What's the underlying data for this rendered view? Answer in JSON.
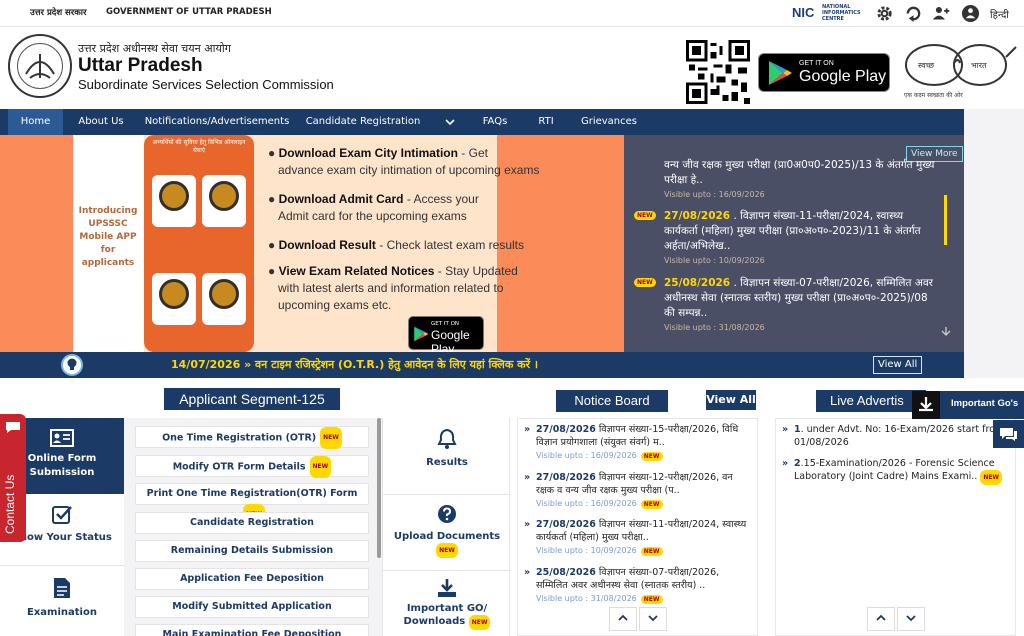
{
  "topbar": {
    "state_hi": "उत्तर प्रदेश सरकार",
    "state_en": "GOVERNMENT OF UTTAR PRADESH",
    "nic_logo": "NIC",
    "nic_sub1": "NATIONAL",
    "nic_sub2": "INFORMATICS",
    "nic_sub3": "CENTRE",
    "icons": [
      "settings-gear-icon",
      "refresh-icon",
      "accessibility-users-icon",
      "screen-reader-icon"
    ],
    "language": "हिन्दी"
  },
  "header": {
    "org_hi": "उत्तर प्रदेश अधीनस्थ सेवा चयन आयोग",
    "org_line1": "Uttar Pradesh",
    "org_line2": "Subordinate Services Selection Commission",
    "gplay_small": "GET IT ON",
    "gplay_big": "Google Play",
    "swachh_1": "स्वच्छ",
    "swachh_2": "भारत",
    "swachh_tag": "एक कदम स्वच्छता की ओर"
  },
  "nav": [
    {
      "label": "Home"
    },
    {
      "label": "About Us"
    },
    {
      "label": "Notifications/Advertisements"
    },
    {
      "label": "Candidate Registration"
    },
    {
      "label": "FAQs"
    },
    {
      "label": "RTI"
    },
    {
      "label": "Grievances"
    }
  ],
  "banner": {
    "mobile_text": "Introducing UPSSSC Mobile APP for applicants",
    "phone_header": "अभ्यर्थियों की सुविधा हेतु विभिन्न ऑनलाइन सेवाएं",
    "lines": [
      {
        "bold": "Download Exam City Intimation",
        "rest": " - Get",
        "line2": "advance exam city intimation of upcoming exams"
      },
      {
        "bold": "Download Admit Card",
        "rest": " - Access your",
        "line2": "Admit card for the upcoming exams"
      },
      {
        "bold": "Download Result",
        "rest": " - Check latest exam results",
        "line2": ""
      },
      {
        "bold": "View Exam Related Notices",
        "rest": " - Stay Updated",
        "line2": "with latest alerts and information related to",
        "line3": "upcoming exams etc."
      }
    ],
    "gp_small": "GET IT ON",
    "gp_big": "Google Play"
  },
  "news": {
    "view_more": "View More",
    "new_label": "NEW",
    "items": [
      {
        "date": "",
        "text": "वन्य जीव रक्षक मुख्य परीक्षा (प्रा0अ0प0-2025)/13 के अंतर्गत मुख्य परीक्षा हे..",
        "visible": "Visible upto : 16/09/2026"
      },
      {
        "date": "27/08/2026",
        "text": " . विज्ञापन संख्या-11-परीक्षा/2024, स्वास्थ्य कार्यकर्ता (महिला) मुख्य परीक्षा (प्रा०अ०प०-2023)/11 के अंतर्गत अर्हता/अभिलेख..",
        "visible": "Visible upto : 10/09/2026"
      },
      {
        "date": "25/08/2026",
        "text": " . विज्ञापन संख्या-07-परीक्षा/2026, सम्मिलित अवर अधीनस्थ सेवा (स्नातक स्तरीय) मुख्य परीक्षा (प्रा०अ०प०-2025)/08 की सम्पन्न..",
        "visible": "Visible upto : 31/08/2026"
      }
    ]
  },
  "ticker": {
    "text": "14/07/2026 » वन टाइम रजिस्ट्रेशन (O.T.R.) हेतु आवेदन के लिए यहां क्लिक करें ।",
    "view_all": "View All"
  },
  "applicant": {
    "title": "Applicant Segment-125",
    "segments": [
      {
        "label": "Online Form Submission",
        "icon": "id-card-icon"
      },
      {
        "label": "Know Your Status",
        "icon": "checkbox-icon"
      },
      {
        "label": "Examination",
        "icon": "document-icon"
      }
    ],
    "options": [
      {
        "label": "One Time Registration (OTR)",
        "new": true
      },
      {
        "label": "Modify OTR Form Details",
        "new": true
      },
      {
        "label": "Print One Time Registration(OTR) Form",
        "new": true
      },
      {
        "label": "Candidate Registration",
        "new": false
      },
      {
        "label": "Remaining Details Submission",
        "new": false
      },
      {
        "label": "Application Fee Deposition",
        "new": false
      },
      {
        "label": "Modify Submitted Application",
        "new": false
      },
      {
        "label": "Main Examination Fee Deposition",
        "new": false
      }
    ],
    "quick": [
      {
        "label": "Results",
        "icon": "bell-icon",
        "new": false
      },
      {
        "label": "Upload Documents",
        "icon": "question-circle-icon",
        "new": true
      },
      {
        "label": "Important GO/ Downloads",
        "icon": "download-icon",
        "new": true
      }
    ]
  },
  "notice_board": {
    "title": "Notice Board",
    "view_all": "View All",
    "items": [
      {
        "date": "27/08/2026",
        "text": " विज्ञापन संख्या-15-परीक्षा/2026, विधि विज्ञान प्रयोगशाला (संयुक्त संवर्ग) म..",
        "visible": "Visible upto : 16/09/2026"
      },
      {
        "date": "27/08/2026",
        "text": " विज्ञापन संख्या-12-परीक्षा/2026, वन रक्षक व वन्य जीव रक्षक मुख्य परीक्षा (प..",
        "visible": "Visible upto : 16/09/2026"
      },
      {
        "date": "27/08/2026",
        "text": " विज्ञापन संख्या-11-परीक्षा/2024, स्वास्थ्य कार्यकर्ता (महिला) मुख्य परीक्षा..",
        "visible": "Visible upto : 10/09/2026"
      },
      {
        "date": "25/08/2026",
        "text": " विज्ञापन संख्या-07-परीक्षा/2026, सम्मिलित अवर अधीनस्थ सेवा (स्नातक स्तरीय) ..",
        "visible": "Visible upto : 31/08/2026"
      }
    ]
  },
  "live_ads": {
    "title": "Live Advertis",
    "items": [
      {
        "num": "1",
        "text": ". under Advt. No: 16-Exam/2026 start from 01/08/2026"
      },
      {
        "num": "2",
        "text": ".15-Examination/2026 - Forensic Science Laboratory (Joint Cadre) Mains Exami.."
      }
    ]
  },
  "floating": {
    "contact": "Contact Us",
    "important_go": "Important Go's"
  },
  "colors": {
    "navy": "#1c3a66",
    "banner_orange": "#fb8c5a",
    "news_bg": "#4a4f66",
    "highlight": "#ffd800",
    "contact_red": "#c7262f"
  }
}
